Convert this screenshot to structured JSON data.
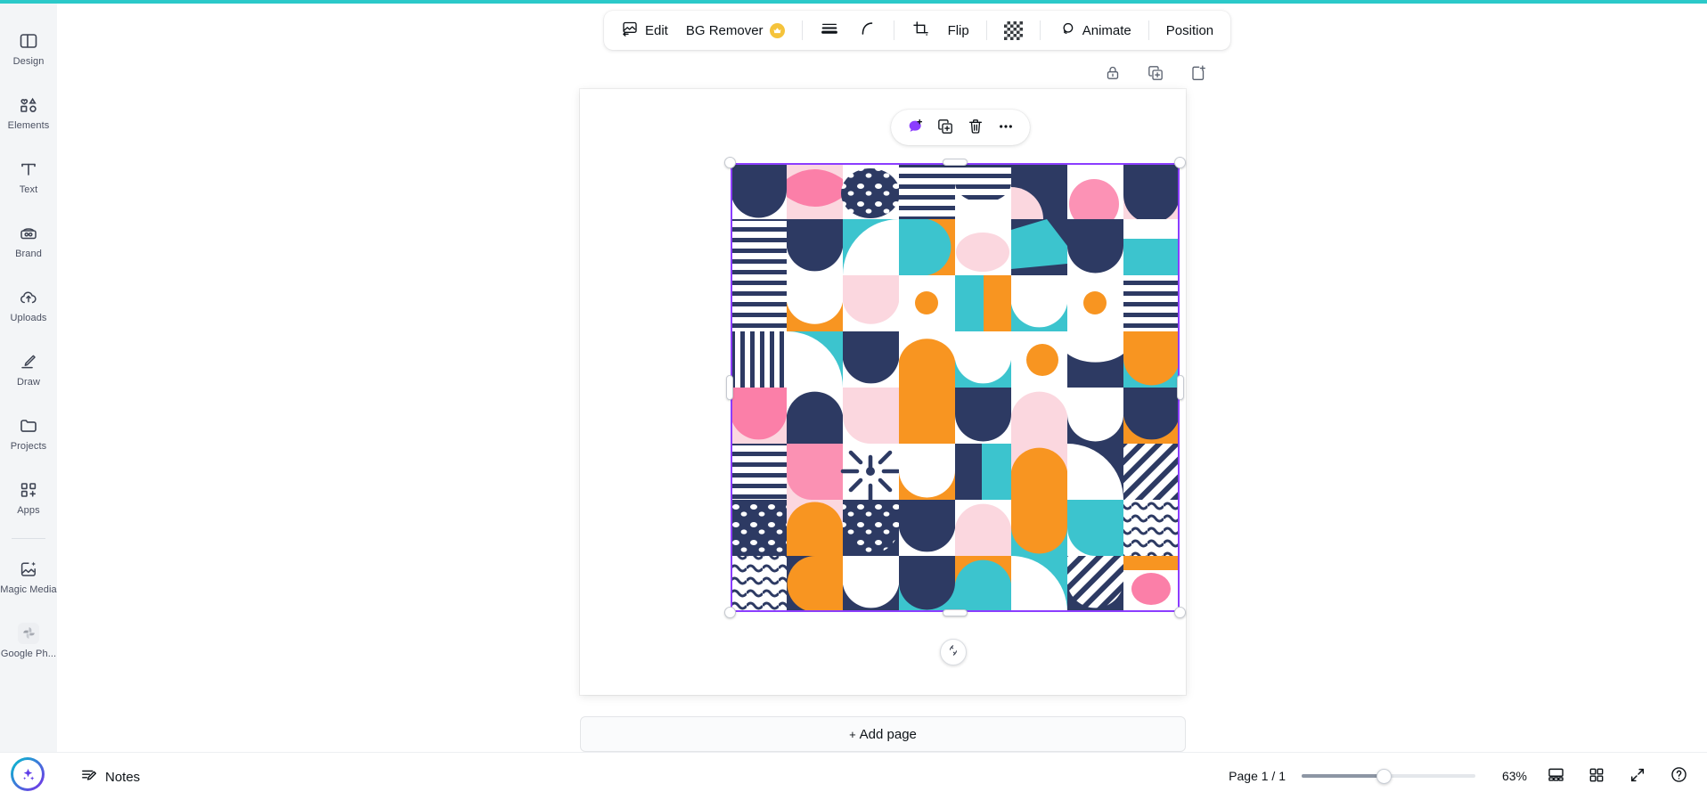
{
  "theme": {
    "accent_teal": "#2BC9C9",
    "selection_purple": "#8B3DFF",
    "premium_gold": "#F5C33B",
    "rail_bg": "#F3F5F7"
  },
  "sidebar": {
    "items": [
      {
        "id": "design",
        "label": "Design",
        "icon": "layout-panel-icon"
      },
      {
        "id": "elements",
        "label": "Elements",
        "icon": "shapes-icon"
      },
      {
        "id": "text",
        "label": "Text",
        "icon": "text-t-icon"
      },
      {
        "id": "brand",
        "label": "Brand",
        "icon": "brand-kit-icon"
      },
      {
        "id": "uploads",
        "label": "Uploads",
        "icon": "cloud-upload-icon"
      },
      {
        "id": "draw",
        "label": "Draw",
        "icon": "pencil-draw-icon"
      },
      {
        "id": "projects",
        "label": "Projects",
        "icon": "folder-icon"
      },
      {
        "id": "apps",
        "label": "Apps",
        "icon": "apps-grid-plus-icon"
      }
    ],
    "extras": [
      {
        "id": "magic-media",
        "label": "Magic Media",
        "icon": "magic-image-icon"
      },
      {
        "id": "google-photos",
        "label": "Google Ph...",
        "icon": "google-photos-icon"
      }
    ]
  },
  "toolbar": {
    "edit_label": "Edit",
    "bg_remover_label": "BG Remover",
    "bg_remover_badge": "crown-icon",
    "transparency_icon": "transparency-checker-icon",
    "lines_icon": "line-weight-icon",
    "curve_icon": "curve-icon",
    "crop_icon": "crop-icon",
    "flip_label": "Flip",
    "animate_label": "Animate",
    "position_label": "Position"
  },
  "page_tools": [
    {
      "id": "lock",
      "label": "Lock",
      "icon": "lock-icon"
    },
    {
      "id": "duplicate",
      "label": "Duplicate",
      "icon": "duplicate-page-icon"
    },
    {
      "id": "add",
      "label": "Add page",
      "icon": "add-page-icon"
    }
  ],
  "context_menu": {
    "items": [
      {
        "id": "comment",
        "label": "Comment",
        "icon": "comment-add-icon"
      },
      {
        "id": "duplicate",
        "label": "Duplicate",
        "icon": "duplicate-icon"
      },
      {
        "id": "delete",
        "label": "Delete",
        "icon": "trash-icon"
      },
      {
        "id": "more",
        "label": "More",
        "icon": "ellipsis-icon"
      }
    ]
  },
  "canvas": {
    "rotate_handle_icon": "rotate-icon",
    "selection": {
      "visible": true,
      "border_color": "#8B3DFF",
      "handles": [
        "top-left",
        "top-right",
        "bottom-left",
        "bottom-right",
        "left",
        "right",
        "top",
        "bottom"
      ]
    },
    "artwork": {
      "name": "abstract-geometric-pattern",
      "palette": {
        "navy": "#2D3A63",
        "orange": "#F89521",
        "teal": "#3CC4CE",
        "pink_light": "#FBD7DF",
        "pink_hot": "#FB7FA8",
        "white": "#FFFFFF"
      }
    }
  },
  "add_page": {
    "plus": "+",
    "label": "Add page"
  },
  "bottom_bar": {
    "magic_button_icon": "magic-sparkle-icon",
    "notes_label": "Notes",
    "notes_icon": "notes-edit-icon",
    "page_count": "Page 1 / 1",
    "zoom_value": "63%",
    "zoom_slider_percent": 47,
    "icons": [
      {
        "id": "timeline",
        "label": "Timeline view",
        "icon": "timeline-icon"
      },
      {
        "id": "grid",
        "label": "Grid view",
        "icon": "grid-view-icon"
      },
      {
        "id": "fullscreen",
        "label": "Fullscreen",
        "icon": "expand-icon"
      },
      {
        "id": "help",
        "label": "Help",
        "icon": "help-circle-icon"
      }
    ]
  }
}
